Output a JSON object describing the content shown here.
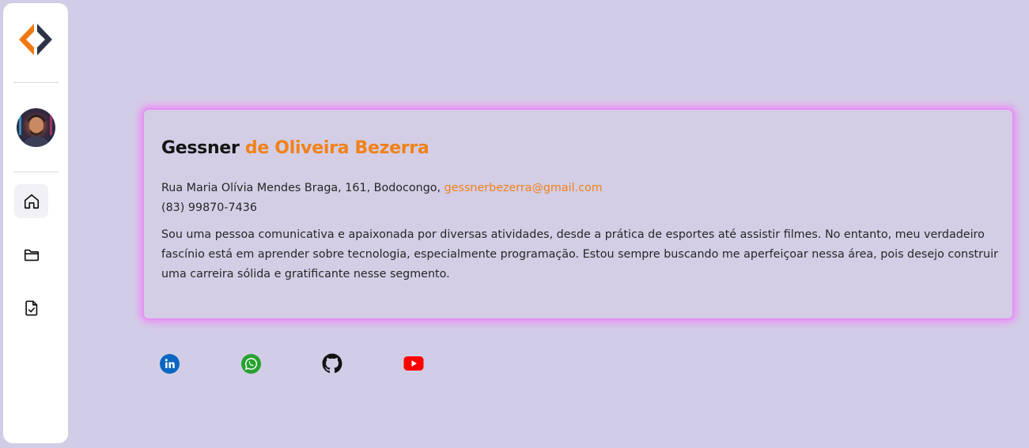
{
  "profile": {
    "first_name": "Gessner",
    "last_name": "de Oliveira Bezerra",
    "address": "Rua Maria Olívia Mendes Braga, 161, Bodocongo,",
    "email": "gessnerbezerra@gmail.com",
    "phone": "(83) 99870-7436",
    "bio": "Sou uma pessoa comunicativa e apaixonada por diversas atividades, desde a prática de esportes até assistir filmes. No entanto, meu verdadeiro fascínio está em aprender sobre tecnologia, especialmente programação. Estou sempre buscando me aperfeiçoar nessa área, pois desejo construir uma carreira sólida e gratificante nesse segmento."
  },
  "sidebar": {
    "logo_icon": "brand-logo-icon",
    "avatar": "profile-avatar",
    "items": [
      {
        "icon": "home-icon",
        "active": true
      },
      {
        "icon": "folder-icon",
        "active": false
      },
      {
        "icon": "file-check-icon",
        "active": false
      }
    ]
  },
  "social": [
    {
      "icon": "linkedin-icon",
      "color": "#0a66c2"
    },
    {
      "icon": "whatsapp-icon",
      "color": "#25a22f"
    },
    {
      "icon": "github-icon",
      "color": "#111111"
    },
    {
      "icon": "youtube-icon",
      "color": "#ff0000"
    }
  ],
  "colors": {
    "background": "#d2cde6",
    "accent": "#f28117",
    "card_glow": "#ec8bf7",
    "sidebar": "#ffffff"
  }
}
